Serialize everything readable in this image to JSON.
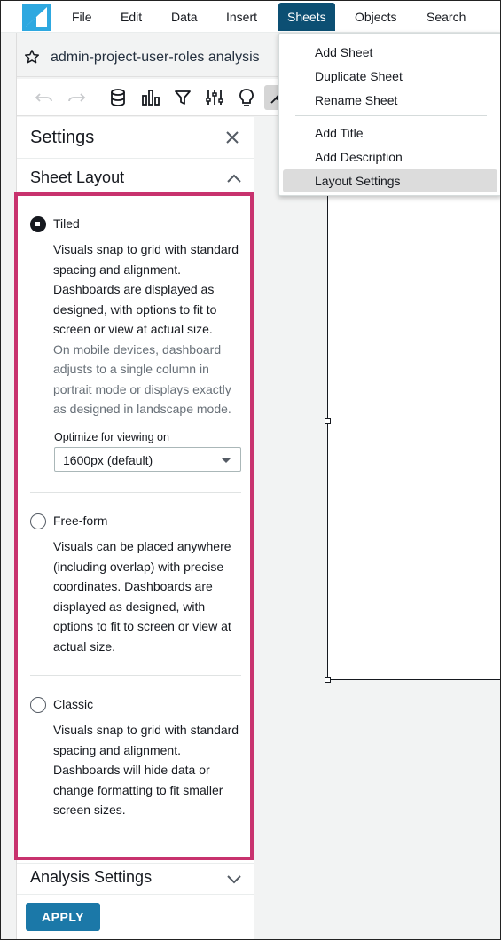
{
  "menubar": {
    "items": [
      "File",
      "Edit",
      "Data",
      "Insert",
      "Sheets",
      "Objects",
      "Search"
    ],
    "active": "Sheets"
  },
  "analysis": {
    "title": "admin-project-user-roles analysis"
  },
  "sheets_menu": {
    "items": [
      "Add Sheet",
      "Duplicate Sheet",
      "Rename Sheet",
      "Add Title",
      "Add Description",
      "Layout Settings"
    ],
    "highlighted": "Layout Settings"
  },
  "settings_panel": {
    "title": "Settings",
    "sheet_layout_title": "Sheet Layout",
    "analysis_settings_title": "Analysis Settings",
    "apply_label": "APPLY",
    "options": {
      "tiled": {
        "label": "Tiled",
        "selected": true,
        "description": "Visuals snap to grid with standard spacing and alignment. Dashboards are displayed as designed, with options to fit to screen or view at actual size.",
        "mobile_note": "On mobile devices, dashboard adjusts to a single column in portrait mode or displays exactly as designed in landscape mode.",
        "optimize_label": "Optimize for viewing on",
        "optimize_value": "1600px (default)"
      },
      "freeform": {
        "label": "Free-form",
        "selected": false,
        "description": "Visuals can be placed anywhere (including overlap) with precise coordinates. Dashboards are displayed as designed, with options to fit to screen or view at actual size."
      },
      "classic": {
        "label": "Classic",
        "selected": false,
        "description": "Visuals snap to grid with standard spacing and alignment. Dashboards will hide data or change formatting to fit smaller screen sizes."
      }
    }
  },
  "colors": {
    "accent_menu": "#0c4f73",
    "highlight_border": "#c8326e",
    "apply_button": "#1b78a8",
    "logo": "#2ea8e0"
  }
}
